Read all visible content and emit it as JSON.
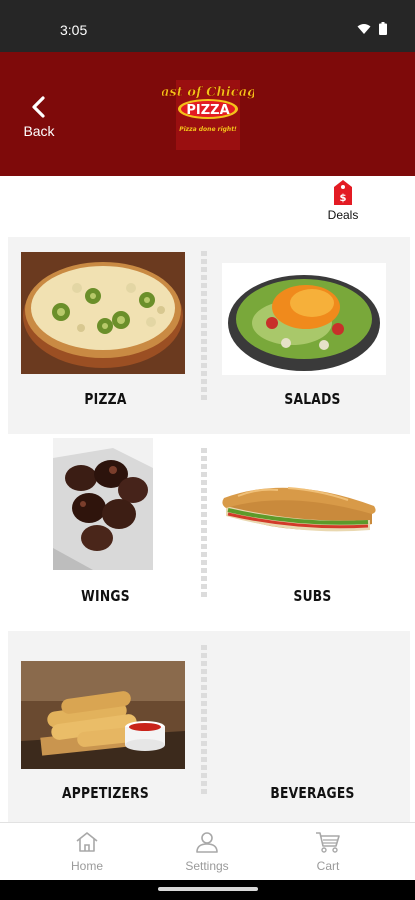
{
  "status_bar": {
    "time": "3:05"
  },
  "header": {
    "back_label": "Back",
    "logo": {
      "line1": "East of Chicago",
      "line2": "PIZZA",
      "tagline": "Pizza done right!"
    }
  },
  "deals": {
    "label": "Deals",
    "icon": "price-tag-icon"
  },
  "categories": [
    {
      "label": "PIZZA",
      "image": "pizza-photo"
    },
    {
      "label": "SALADS",
      "image": "salad-photo"
    },
    {
      "label": "WINGS",
      "image": "wings-photo"
    },
    {
      "label": "SUBS",
      "image": "sub-sandwich-photo"
    },
    {
      "label": "APPETIZERS",
      "image": "breadsticks-photo"
    },
    {
      "label": "BEVERAGES",
      "image": ""
    }
  ],
  "bottom_nav": [
    {
      "label": "Home",
      "icon": "home-icon"
    },
    {
      "label": "Settings",
      "icon": "person-icon"
    },
    {
      "label": "Cart",
      "icon": "cart-icon"
    }
  ],
  "colors": {
    "header": "#7e0a0a",
    "accent": "#e31b23",
    "status_bar": "#262626",
    "row_gray": "#f3f3f3"
  }
}
